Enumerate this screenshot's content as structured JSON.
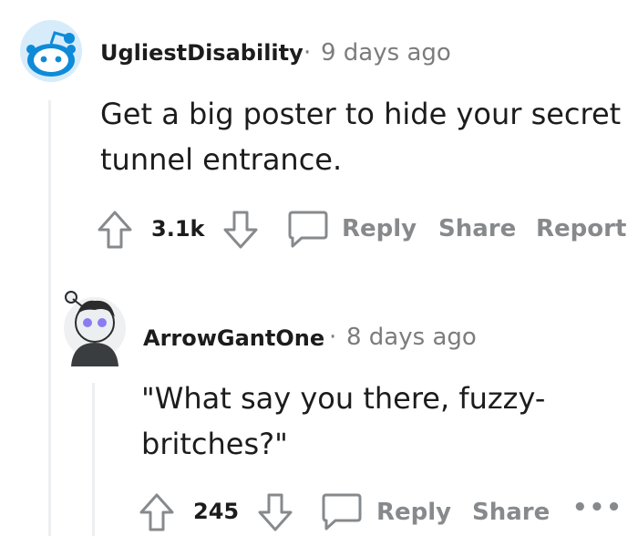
{
  "comment": {
    "author": "UgliestDisability",
    "separator": "·",
    "time": "9 days ago",
    "body": "Get a big poster to hide your secret tunnel entrance.",
    "score": "3.1k",
    "actions": {
      "reply": "Reply",
      "share": "Share",
      "report": "Report"
    },
    "icons": {
      "avatar": "reddit-snoo-avatar-icon",
      "upvote": "upvote-arrow-icon",
      "downvote": "downvote-arrow-icon",
      "comment": "comment-bubble-icon"
    }
  },
  "reply": {
    "author": "ArrowGantOne",
    "separator": "·",
    "time": "8 days ago",
    "body": "\"What say you there, fuzzy-britches?\"",
    "score": "245",
    "actions": {
      "reply": "Reply",
      "share": "Share",
      "more": "•••"
    },
    "icons": {
      "avatar": "snoo-custom-avatar-icon",
      "upvote": "upvote-arrow-icon",
      "downvote": "downvote-arrow-icon",
      "comment": "comment-bubble-icon",
      "more": "more-options-icon"
    }
  }
}
